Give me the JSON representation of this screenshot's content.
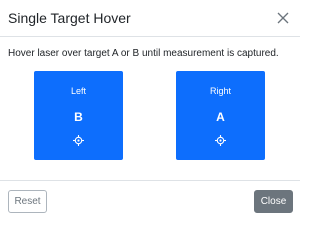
{
  "dialog": {
    "title": "Single Target Hover",
    "close_icon": "close-icon"
  },
  "body": {
    "instruction": "Hover laser over target A or B until measurement is captured."
  },
  "targets": [
    {
      "label": "Left",
      "letter": "B",
      "icon": "crosshair-icon",
      "color": "#0d6efd"
    },
    {
      "label": "Right",
      "letter": "A",
      "icon": "crosshair-icon",
      "color": "#0d6efd"
    }
  ],
  "footer": {
    "reset_label": "Reset",
    "close_label": "Close"
  },
  "colors": {
    "accent": "#0d6efd",
    "secondary": "#6c757d",
    "border": "#dee2e6"
  }
}
